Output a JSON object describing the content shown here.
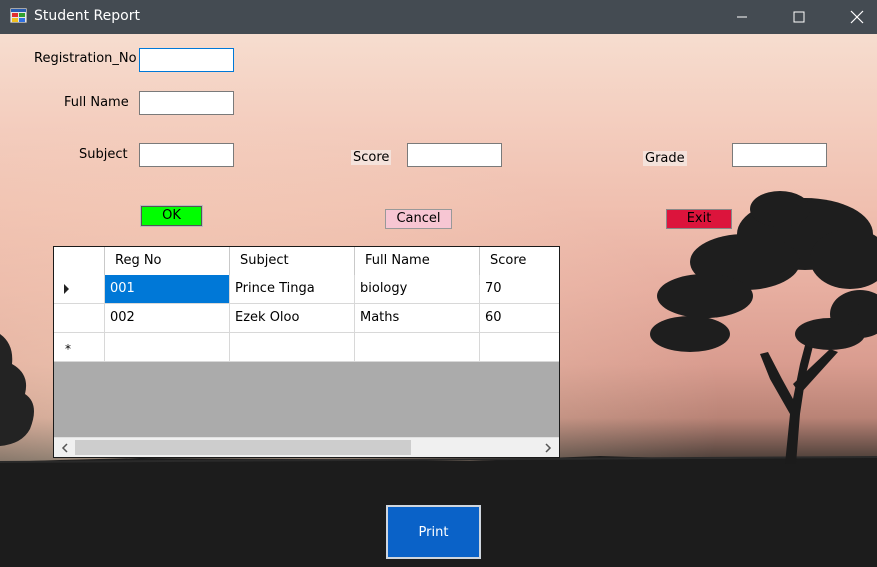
{
  "window": {
    "title": "Student Report"
  },
  "form": {
    "registration_label": "Registration_No",
    "fullname_label": "Full Name",
    "subject_label": "Subject",
    "score_label": "Score",
    "grade_label": "Grade",
    "registration_value": "",
    "fullname_value": "",
    "subject_value": "",
    "score_value": "",
    "grade_value": ""
  },
  "buttons": {
    "ok": "OK",
    "cancel": "Cancel",
    "exit": "Exit",
    "print": "Print"
  },
  "colors": {
    "ok": "#00ff00",
    "cancel": "#f7c6d3",
    "exit": "#dc143c",
    "print": "#0a62c8",
    "titlebar": "#444b52",
    "selection": "#0078d7"
  },
  "grid": {
    "columns": [
      "Reg No",
      "Subject",
      "Full Name",
      "Score"
    ],
    "rows": [
      [
        "001",
        "Prince Tinga",
        "biology",
        "70"
      ],
      [
        "002",
        "Ezek Oloo",
        "Maths",
        "60"
      ]
    ],
    "new_row_marker": "*"
  }
}
